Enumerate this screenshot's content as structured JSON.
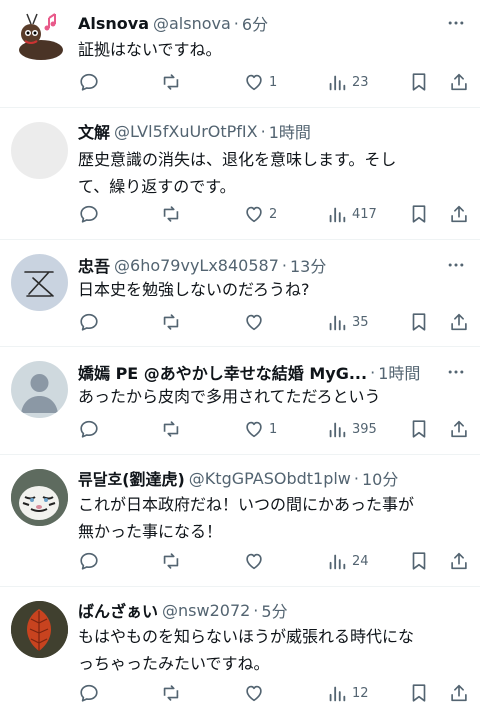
{
  "replies": [
    {
      "name": "Alsnova",
      "handle": "@alsnova",
      "sep": "·",
      "time": "6分",
      "lines": [
        "証拠はないですね。"
      ],
      "likes": "1",
      "retweets": "",
      "replies": "",
      "views": "23",
      "avatar": "cartoon-bird"
    },
    {
      "name": "文解",
      "handle": "@LVl5fXuUrOtPfIX",
      "sep": "·",
      "time": "1時間",
      "lines": [
        "歴史意識の消失は、退化を意味します。そし",
        "て、繰り返すのです。"
      ],
      "likes": "2",
      "retweets": "",
      "replies": "",
      "views": "417",
      "avatar": "blank"
    },
    {
      "name": "忠吾",
      "handle": "@6ho79vyLx840587",
      "sep": "·",
      "time": "13分",
      "lines": [
        "日本史を勉強しないのだろうね?"
      ],
      "likes": "",
      "retweets": "",
      "replies": "",
      "views": "35",
      "avatar": "sketch"
    },
    {
      "name": "嬌嫣 PE @あやかし幸せな結婚 MyG...",
      "handle": "",
      "sep": "·",
      "time": "1時間",
      "lines": [
        "あったから皮肉で多用されてただろという"
      ],
      "likes": "1",
      "retweets": "",
      "replies": "",
      "views": "395",
      "avatar": "default"
    },
    {
      "name": "류달호(劉達虎)",
      "handle": "@KtgGPASObdt1plw",
      "sep": "·",
      "time": "10分",
      "lines": [
        "これが日本政府だね！いつの間にかあった事が",
        "無かった事になる！"
      ],
      "likes": "",
      "retweets": "",
      "replies": "",
      "views": "24",
      "avatar": "tiger"
    },
    {
      "name": "ばんざぁい",
      "handle": "@nsw2072",
      "sep": "·",
      "time": "5分",
      "lines": [
        "もはやものを知らないほうが威張れる時代にな",
        "っちゃったみたいですね。"
      ],
      "likes": "",
      "retweets": "",
      "replies": "",
      "views": "12",
      "avatar": "leaf"
    }
  ]
}
